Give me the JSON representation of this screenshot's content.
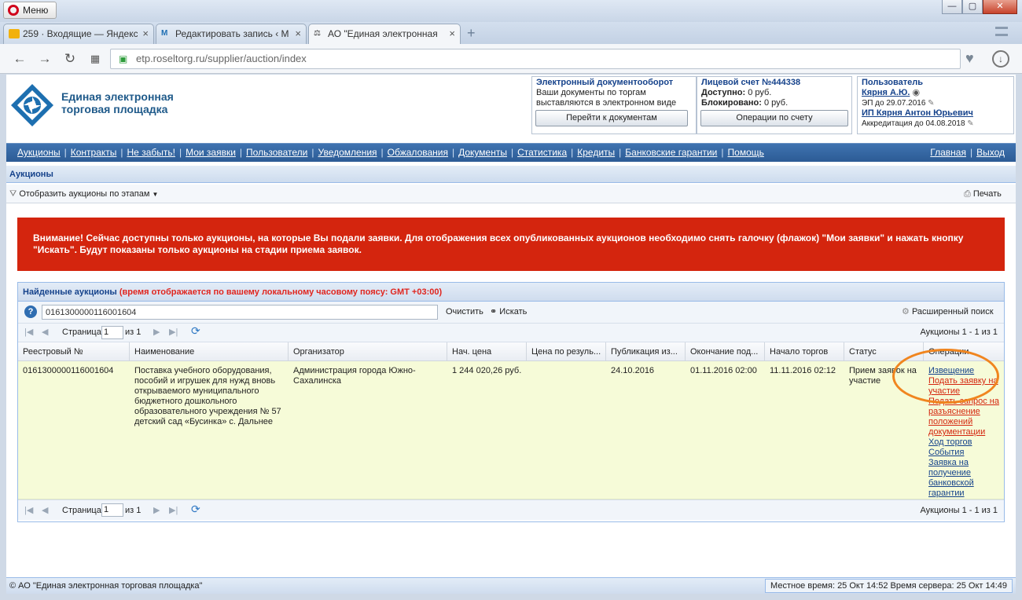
{
  "browser": {
    "menu_label": "Меню",
    "tabs": [
      {
        "label": "259 · Входящие — Яндекс",
        "icon": "mail-icon"
      },
      {
        "label": "Редактировать запись ‹ М",
        "icon": "wordpress-icon"
      },
      {
        "label": "АО \"Единая электронная",
        "icon": "gavel-icon"
      }
    ],
    "url": "etp.roseltorg.ru/supplier/auction/index"
  },
  "header": {
    "logo_text": "Единая электронная торговая площадка",
    "edo": {
      "title": "Электронный документооборот",
      "line1": "Ваши документы по торгам",
      "line2": "выставляются в электронном виде",
      "button": "Перейти к документам"
    },
    "account": {
      "title": "Лицевой счет №444338",
      "available_label": "Доступно:",
      "available_value": "0 руб.",
      "blocked_label": "Блокировано:",
      "blocked_value": "0 руб.",
      "button": "Операции по счету"
    },
    "user": {
      "title": "Пользователь",
      "name": "Кярня А.Ю.",
      "ep": "ЭП до 29.07.2016",
      "org": "ИП Кярня Антон Юрьевич",
      "accreditation": "Аккредитация до 04.08.2018"
    }
  },
  "menu": {
    "left": [
      "Аукционы",
      "Контракты",
      "Не забыть!",
      "Мои заявки",
      "Пользователи",
      "Уведомления",
      "Обжалования",
      "Документы",
      "Статистика",
      "Кредиты",
      "Банковские гарантии",
      "Помощь"
    ],
    "right": [
      "Главная",
      "Выход"
    ]
  },
  "panel": {
    "title": "Аукционы",
    "filter_label": "Отобразить аукционы по этапам",
    "print_label": "Печать"
  },
  "warning": {
    "text": "Внимание! Сейчас доступны только аукционы, на которые Вы подали заявки. Для отображения всех опубликованных аукционов необходимо снять галочку (флажок) \"Мои заявки\" и нажать кнопку \"Искать\". Будут показаны только аукционы на стадии приема заявок."
  },
  "grid": {
    "title": "Найденные аукционы",
    "title_note": "(время отображается по вашему локальному часовому поясу: GMT +03:00)",
    "search_value": "0161300000116001604",
    "clear_label": "Очистить",
    "search_label": "Искать",
    "advanced_label": "Расширенный поиск",
    "pager": {
      "page_label": "Страница",
      "page_value": "1",
      "of_label": "из 1",
      "count": "Аукционы 1 - 1 из 1"
    },
    "columns": [
      "Реестровый №",
      "Наименование",
      "Организатор",
      "Нач. цена",
      "Цена по резуль...",
      "Публикация из...",
      "Окончание под...",
      "Начало торгов",
      "Статус",
      "Операции"
    ],
    "row": {
      "reg_no": "0161300000116001604",
      "name": "Поставка учебного оборудования, пособий и игрушек для нужд вновь открываемого муниципального бюджетного дошкольного образовательного учреждения № 57 детский сад «Бусинка» с. Дальнее",
      "organizer": "Администрация города Южно-Сахалинска",
      "start_price": "1 244 020,26 руб.",
      "result_price": "",
      "published": "24.10.2016",
      "end_apps": "01.11.2016 02:00",
      "start_trade": "11.11.2016 02:12",
      "status": "Прием заявок на участие",
      "operations": [
        {
          "label": "Извещение",
          "color": "blue"
        },
        {
          "label": "Подать заявку на участие",
          "color": "red"
        },
        {
          "label": "Подать запрос на разъяснение положений документации",
          "color": "red"
        },
        {
          "label": "Ход торгов",
          "color": "blue"
        },
        {
          "label": "События",
          "color": "blue"
        },
        {
          "label": "Заявка на получение банковской гарантии",
          "color": "blue"
        }
      ]
    }
  },
  "footer": {
    "copyright": "© АО \"Единая электронная торговая площадка\"",
    "time": "Местное время: 25 Окт 14:52 Время сервера: 25 Окт 14:49"
  },
  "colors": {
    "accent": "#2c5b95",
    "warning": "#d4250e",
    "highlight_ring": "#f0851f",
    "row_bg": "#f6fbd8"
  }
}
